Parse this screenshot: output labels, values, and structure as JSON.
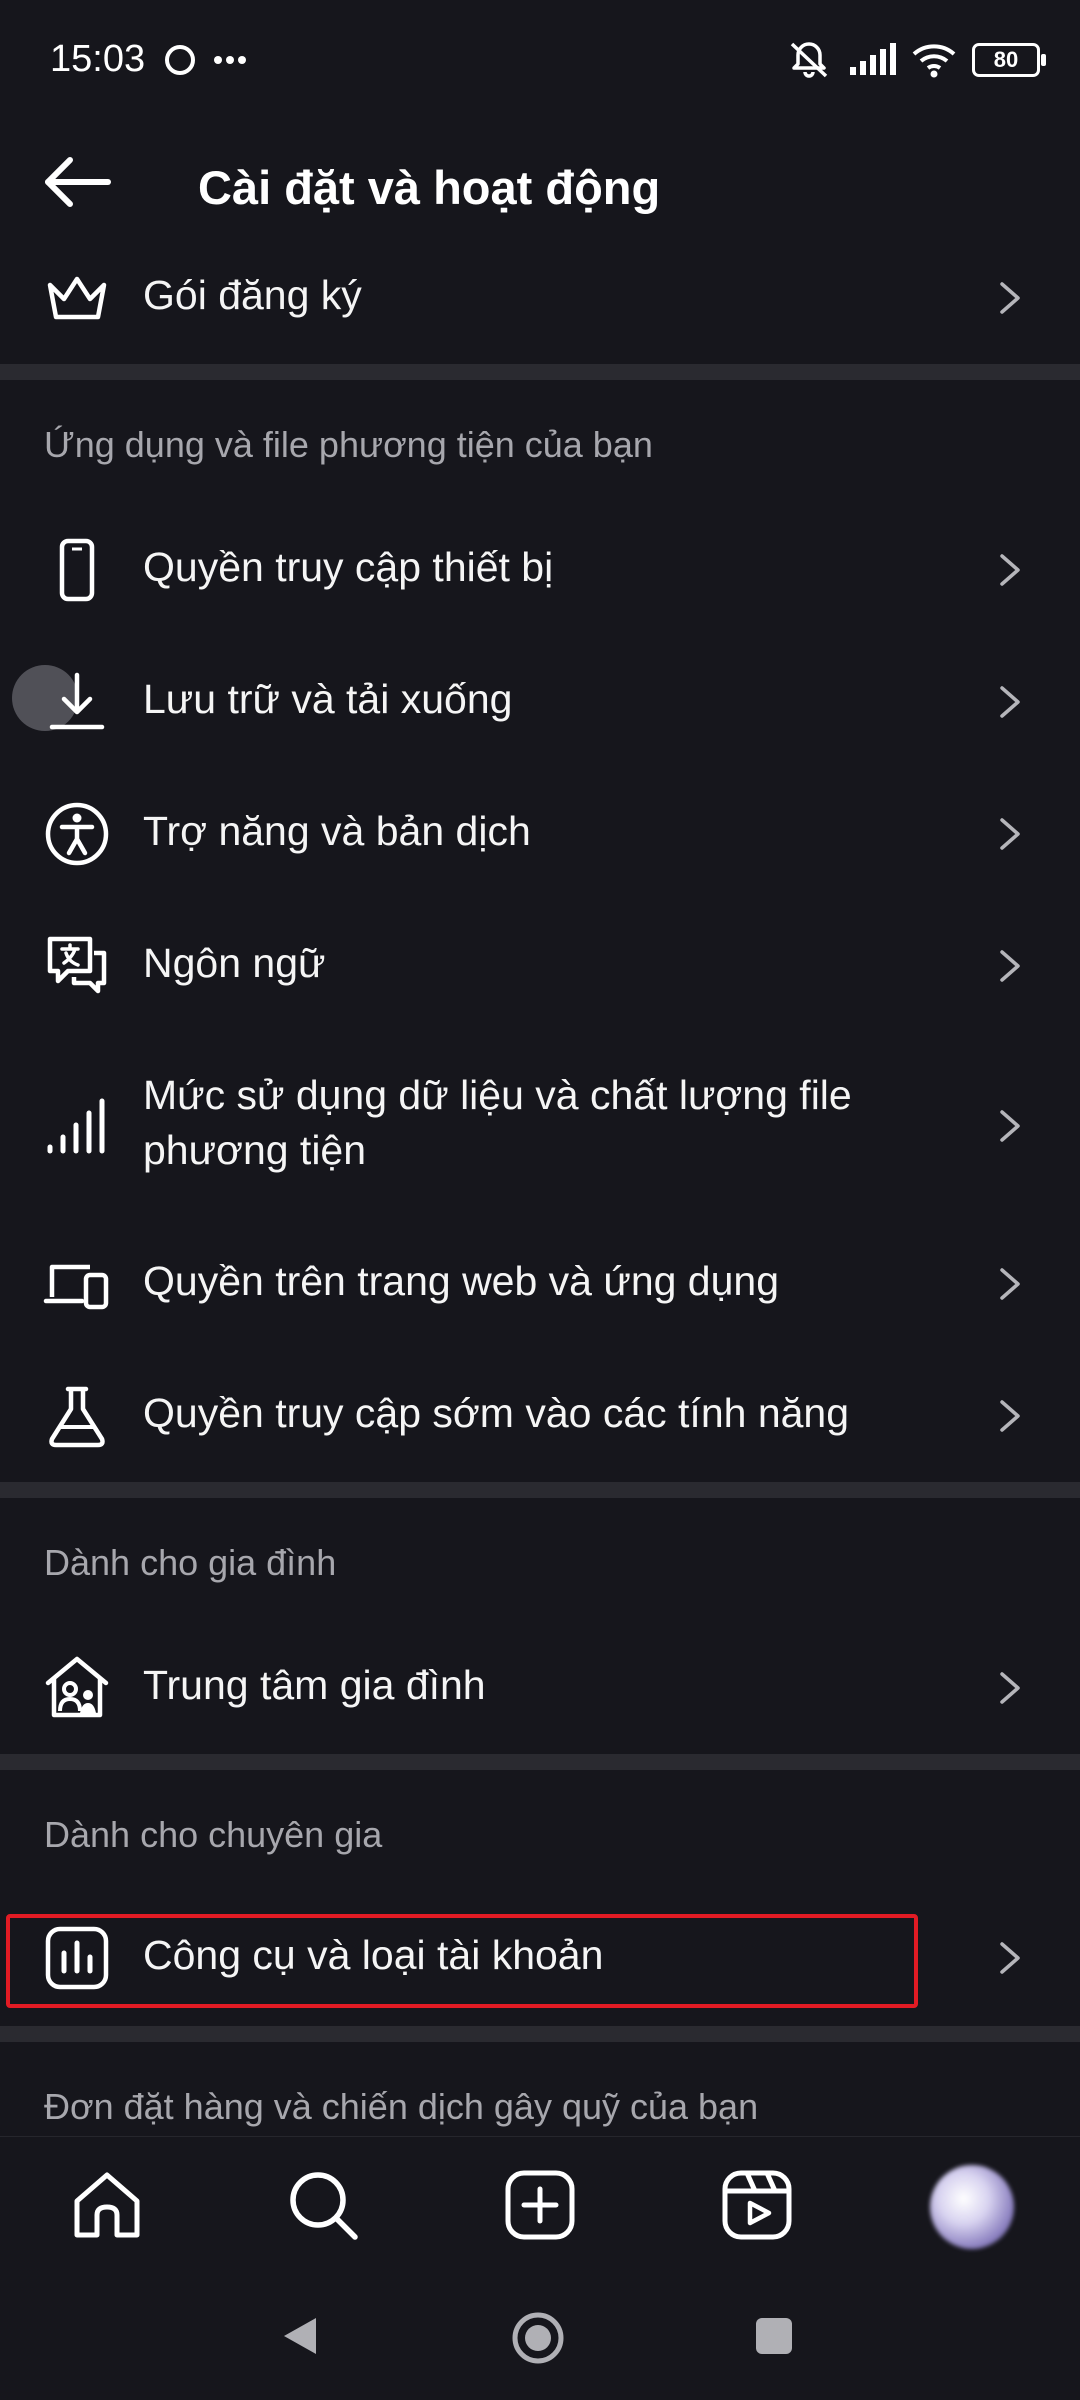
{
  "status": {
    "time": "15:03",
    "battery": "80"
  },
  "header": {
    "title": "Cài đặt và hoạt động"
  },
  "rows": {
    "subscriptions": "Gói đăng ký",
    "device_permissions": "Quyền truy cập thiết bị",
    "archive_downloads": "Lưu trữ và tải xuống",
    "accessibility": "Trợ năng và bản dịch",
    "language": "Ngôn ngữ",
    "data_usage": "Mức sử dụng dữ liệu và chất lượng file phương tiện",
    "web_app_permissions": "Quyền trên trang web và ứng dụng",
    "early_access": "Quyền truy cập sớm vào các tính năng",
    "family_center": "Trung tâm gia đình",
    "creator_tools": "Công cụ và loại tài khoản"
  },
  "sections": {
    "apps_media": "Ứng dụng và file phương tiện của bạn",
    "family": "Dành cho gia đình",
    "professionals": "Dành cho chuyên gia",
    "orders": "Đơn đặt hàng và chiến dịch gây quỹ của bạn"
  },
  "icons": {
    "back": "back-arrow-icon",
    "crown": "crown-icon",
    "phone": "phone-icon",
    "download": "download-icon",
    "accessibility": "accessibility-icon",
    "language": "translate-bubble-icon",
    "signal": "signal-bars-icon",
    "devices": "devices-icon",
    "flask": "flask-icon",
    "family": "family-home-icon",
    "chart": "bar-chart-icon",
    "chevron": "chevron-right-icon"
  },
  "colors": {
    "background": "#16161c",
    "highlight": "#e21b24",
    "divider": "#2a2a30",
    "secondary_text": "#a7a7ad"
  }
}
